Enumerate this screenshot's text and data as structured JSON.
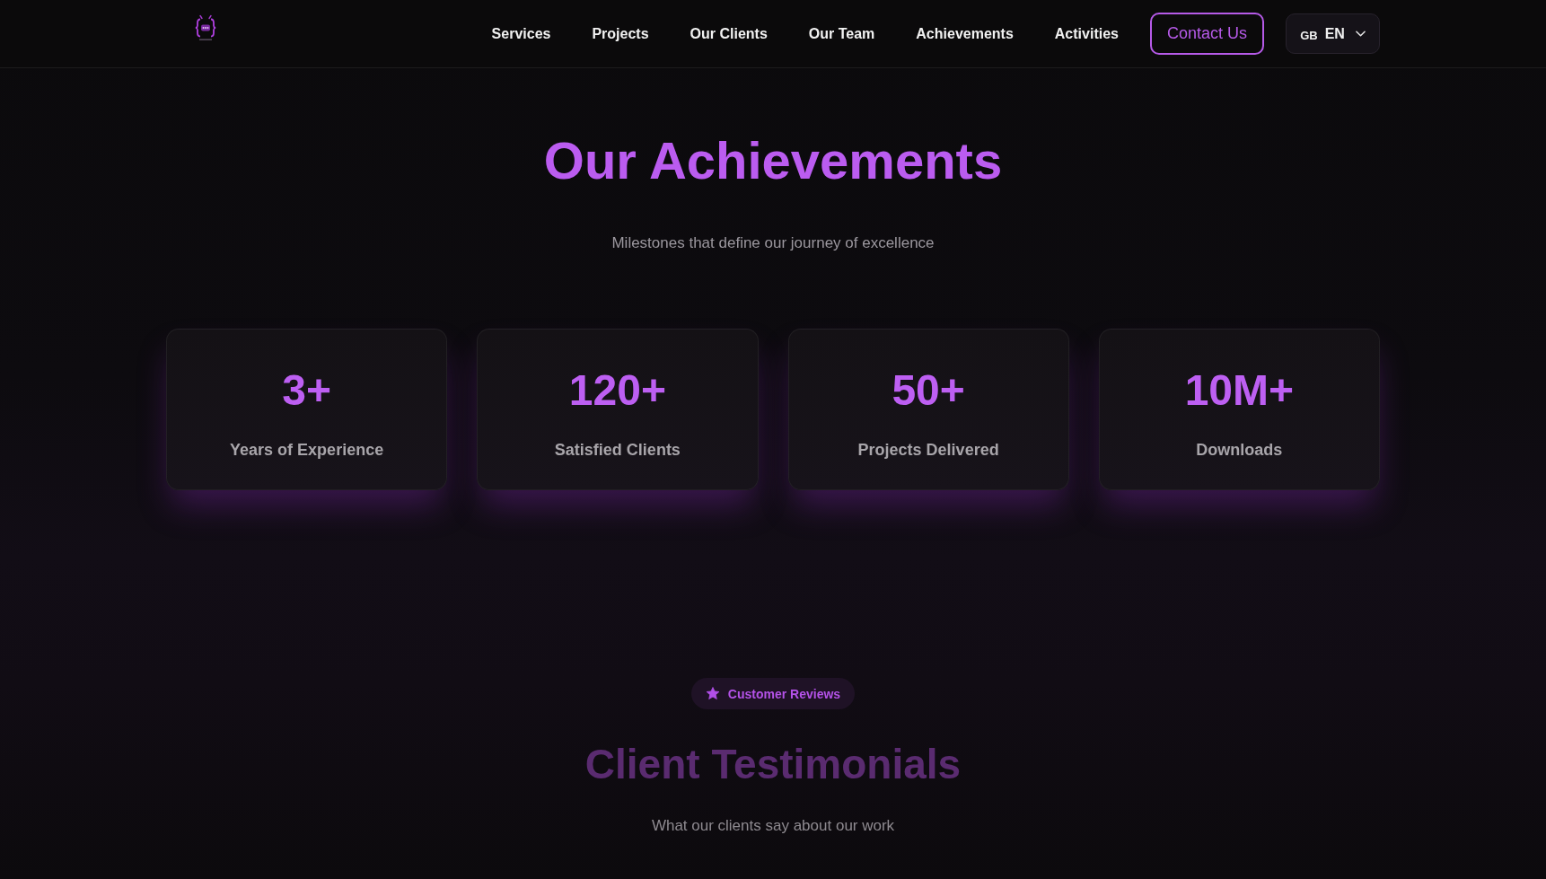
{
  "nav": {
    "links": [
      "Services",
      "Projects",
      "Our Clients",
      "Our Team",
      "Achievements",
      "Activities"
    ],
    "contact_button": "Contact Us",
    "language": {
      "flag": "GB",
      "code": "EN"
    }
  },
  "achievements": {
    "title": "Our Achievements",
    "subtitle": "Milestones that define our journey of excellence",
    "stats": [
      {
        "value": "3+",
        "label": "Years of Experience"
      },
      {
        "value": "120+",
        "label": "Satisfied Clients"
      },
      {
        "value": "50+",
        "label": "Projects Delivered"
      },
      {
        "value": "10M+",
        "label": "Downloads"
      }
    ]
  },
  "testimonials": {
    "tag": "Customer Reviews",
    "title": "Client Testimonials",
    "subtitle": "What our clients say about our work"
  }
}
